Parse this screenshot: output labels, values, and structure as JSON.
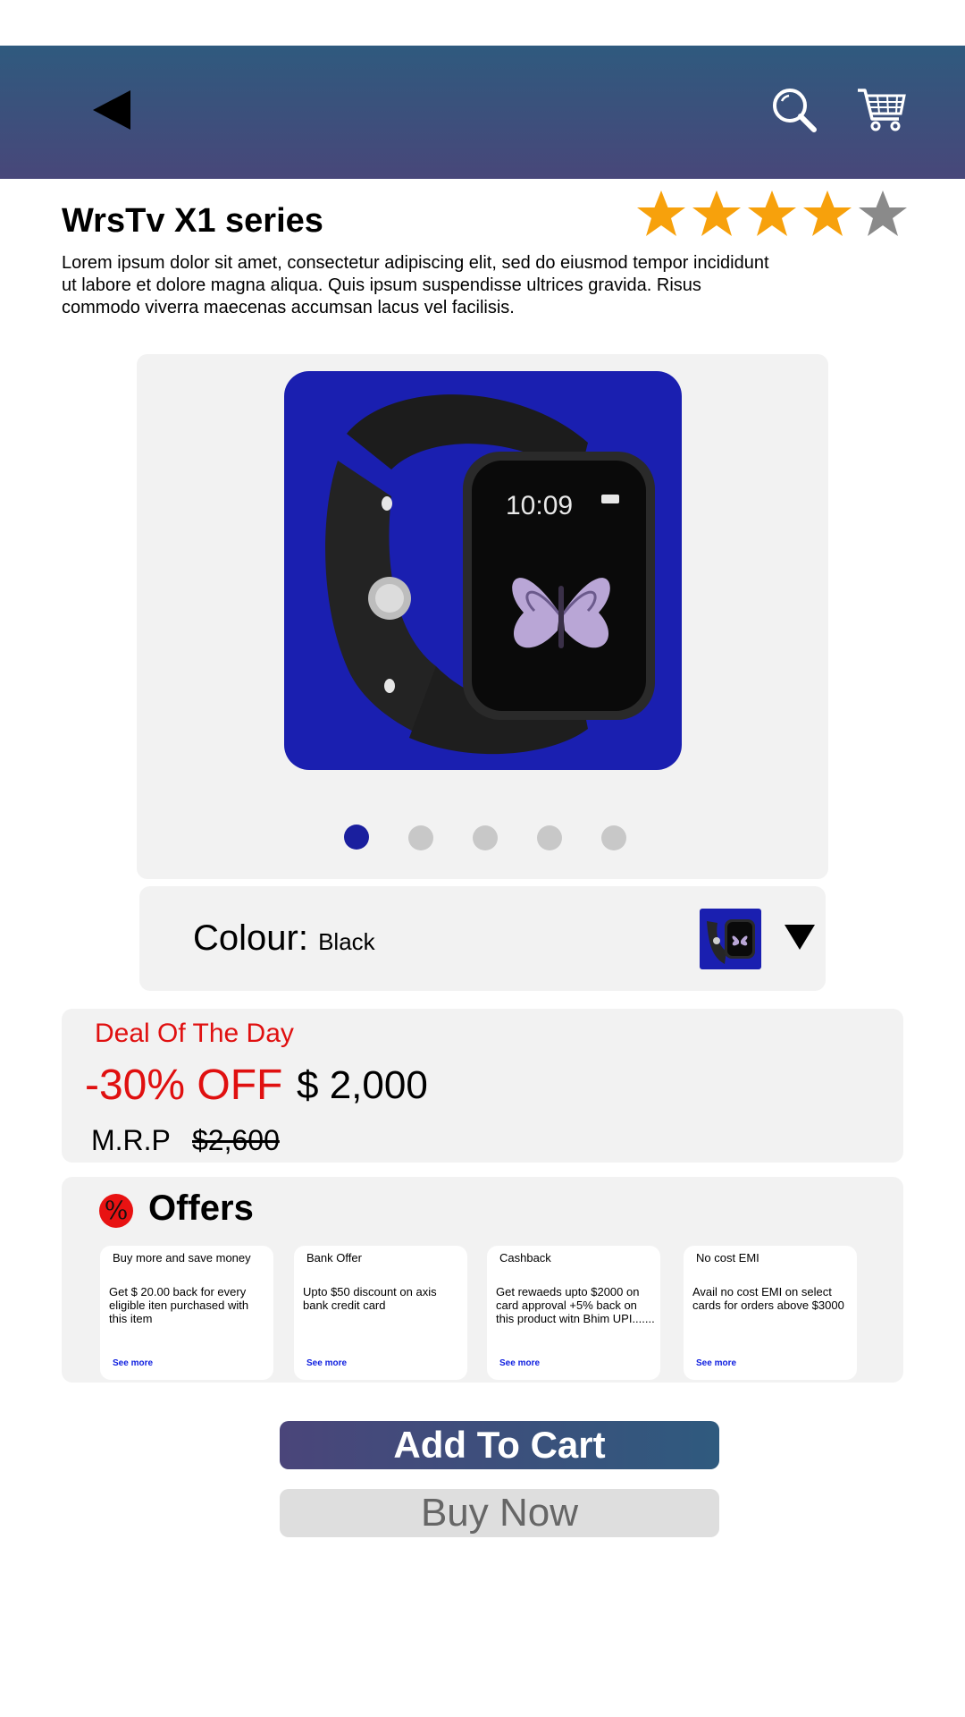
{
  "header": {
    "back_icon": "back-arrow-icon",
    "search_icon": "search-icon",
    "cart_icon": "cart-icon",
    "background": [
      "#2f5a7e",
      "#48477a"
    ]
  },
  "product": {
    "title": "WrsTv X1 series",
    "rating": 4,
    "rating_max": 5,
    "description": "Lorem ipsum dolor sit amet, consectetur adipiscing elit, sed do eiusmod tempor incididunt ut labore et dolore magna aliqua. Quis ipsum suspendisse ultrices gravida. Risus commodo viverra maecenas accumsan lacus vel facilisis.",
    "image_time": "10:09"
  },
  "gallery": {
    "slide_count": 5,
    "active_index": 0
  },
  "colour": {
    "label": "Colour:",
    "value": "Black"
  },
  "deal": {
    "title": "Deal Of The Day",
    "discount": "-30% OFF",
    "price": "$ 2,000",
    "mrp_label": "M.R.P",
    "mrp_value": "$2,600"
  },
  "offers": {
    "icon": "%",
    "title": "Offers",
    "cards": [
      {
        "title": "Buy more and save money",
        "body": "Get $ 20.00 back for every eligible iten purchased with this item",
        "link": "See more"
      },
      {
        "title": "Bank Offer",
        "body": "Upto $50 discount on axis bank credit card",
        "link": "See more"
      },
      {
        "title": "Cashback",
        "body": "Get rewaeds upto $2000 on card approval +5% back on this product witn Bhim UPI.......",
        "link": "See more"
      },
      {
        "title": "No cost EMI",
        "body": "Avail no cost EMI on select cards for orders above $3000",
        "link": "See more"
      }
    ]
  },
  "actions": {
    "add_to_cart": "Add To Cart",
    "buy_now": "Buy Now"
  },
  "colors": {
    "accent_red": "#e01010",
    "star_gold": "#f7a10c",
    "star_grey": "#8a8a8a",
    "product_bg": "#1a1fb0"
  }
}
